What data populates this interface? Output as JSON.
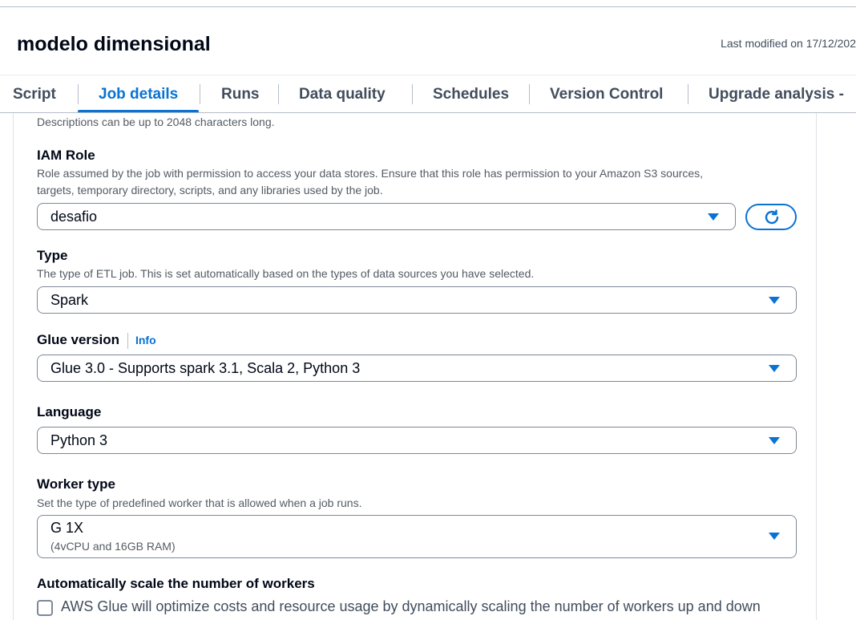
{
  "header": {
    "title": "modelo dimensional",
    "last_modified": "Last modified on 17/12/202"
  },
  "tabs": [
    {
      "label": "Script",
      "active": false
    },
    {
      "label": "Job details",
      "active": true
    },
    {
      "label": "Runs",
      "active": false
    },
    {
      "label": "Data quality",
      "active": false
    },
    {
      "label": "Schedules",
      "active": false
    },
    {
      "label": "Version Control",
      "active": false
    },
    {
      "label": "Upgrade analysis - ",
      "active": false
    }
  ],
  "form": {
    "description_hint": "Descriptions can be up to 2048 characters long.",
    "iam_role": {
      "label": "IAM Role",
      "description_line1": "Role assumed by the job with permission to access your data stores. Ensure that this role has permission to your Amazon S3 sources,",
      "description_line2": "targets, temporary directory, scripts, and any libraries used by the job.",
      "value": "desafio"
    },
    "type": {
      "label": "Type",
      "description": "The type of ETL job. This is set automatically based on the types of data sources you have selected.",
      "value": "Spark"
    },
    "glue_version": {
      "label": "Glue version",
      "info": "Info",
      "value": "Glue 3.0 - Supports spark 3.1, Scala 2, Python 3"
    },
    "language": {
      "label": "Language",
      "value": "Python 3"
    },
    "worker_type": {
      "label": "Worker type",
      "description": "Set the type of predefined worker that is allowed when a job runs.",
      "value": "G 1X",
      "value_detail": "(4vCPU and 16GB RAM)"
    },
    "autoscale": {
      "label": "Automatically scale the number of workers",
      "checkbox_label": "AWS Glue will optimize costs and resource usage by dynamically scaling the number of workers up and down",
      "checked": false
    }
  },
  "colors": {
    "accent": "#0972d3",
    "text": "#000716",
    "muted": "#545b64",
    "border": "#7d8998"
  },
  "icons": {
    "refresh": "refresh-icon",
    "dropdown": "caret-down-icon"
  }
}
